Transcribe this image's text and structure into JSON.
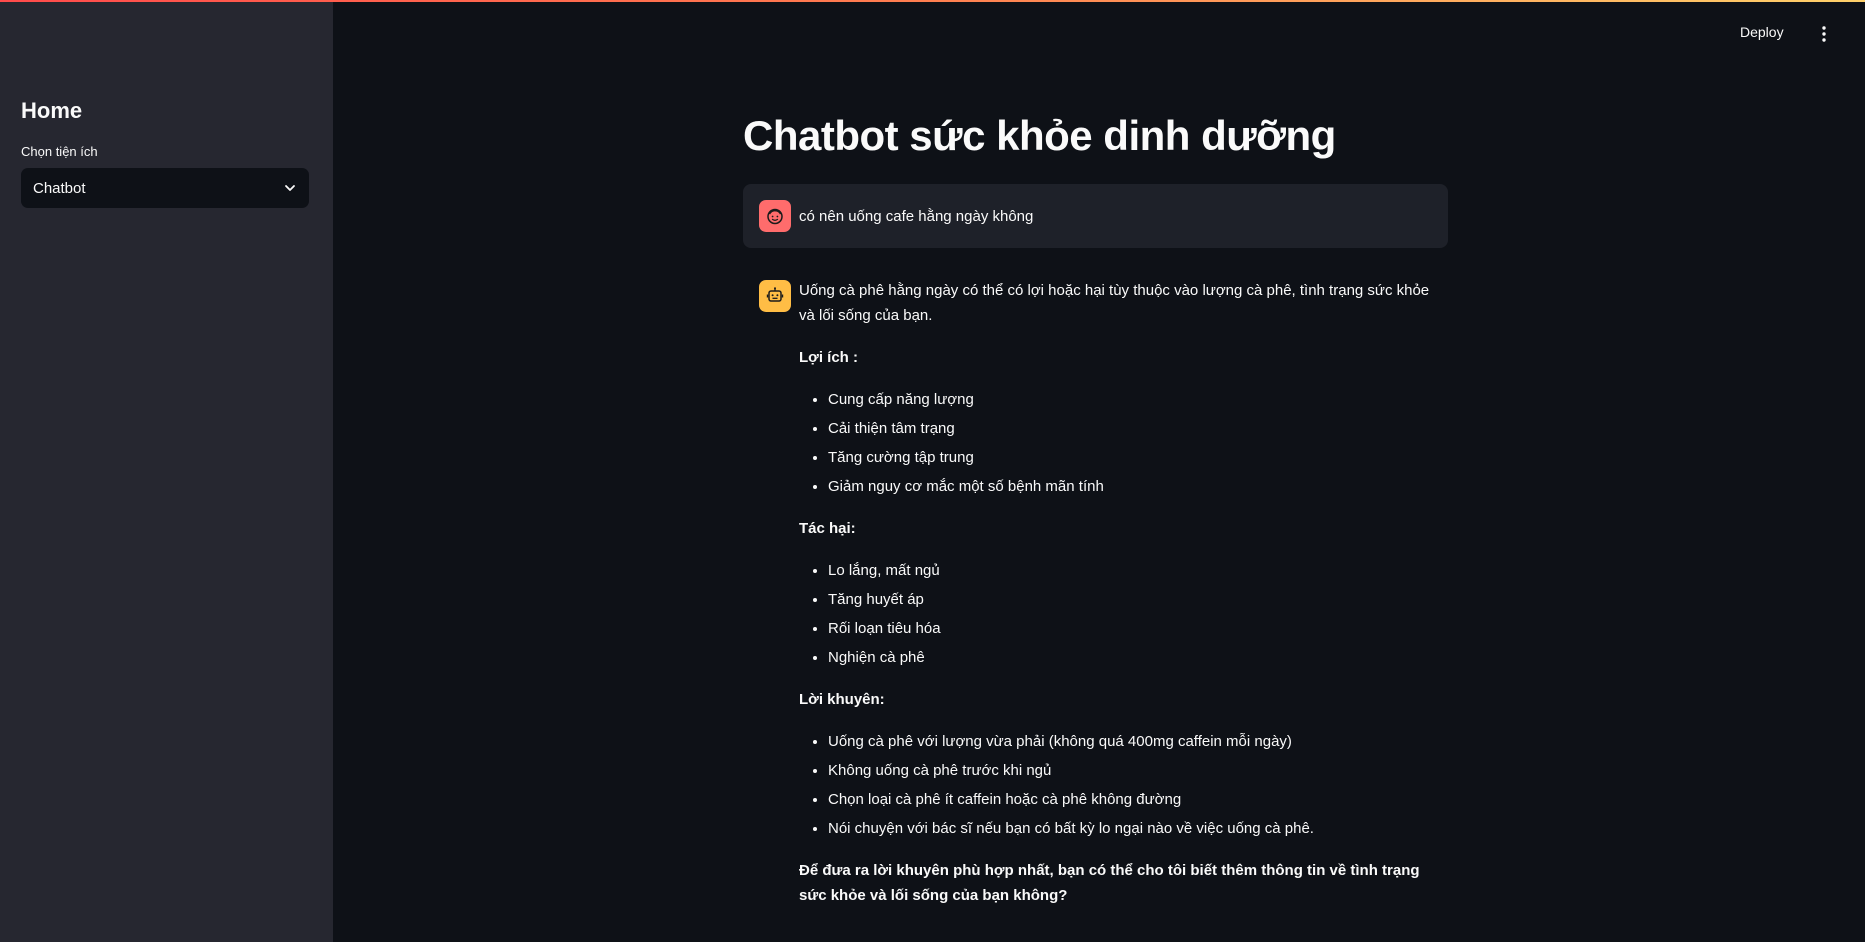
{
  "sidebar": {
    "title": "Home",
    "select_label": "Chọn tiện ích",
    "select_value": "Chatbot"
  },
  "header": {
    "deploy_label": "Deploy",
    "menu_icon": "vertical-dots-icon"
  },
  "main": {
    "title": "Chatbot sức khỏe dinh dưỡng",
    "user_message": {
      "avatar_icon": "user-face-icon",
      "avatar_color": "#ff6c6c",
      "text": "có nên uống cafe hằng ngày không"
    },
    "assistant_message": {
      "avatar_icon": "robot-icon",
      "avatar_color": "#ffbd45",
      "intro": "Uống cà phê hằng ngày có thể có lợi hoặc hại tùy thuộc vào lượng cà phê, tình trạng sức khỏe và lối sống của bạn.",
      "benefits_heading": "Lợi ích :",
      "benefits": [
        "Cung cấp năng lượng",
        "Cải thiện tâm trạng",
        "Tăng cường tập trung",
        "Giảm nguy cơ mắc một số bệnh mãn tính"
      ],
      "harms_heading": "Tác hại:",
      "harms": [
        "Lo lắng, mất ngủ",
        "Tăng huyết áp",
        "Rối loạn tiêu hóa",
        "Nghiện cà phê"
      ],
      "advice_heading": "Lời khuyên:",
      "advice": [
        "Uống cà phê với lượng vừa phải (không quá 400mg caffein mỗi ngày)",
        "Không uống cà phê trước khi ngủ",
        "Chọn loại cà phê ít caffein hoặc cà phê không đường",
        "Nói chuyện với bác sĩ nếu bạn có bất kỳ lo ngại nào về việc uống cà phê."
      ],
      "closing": "Để đưa ra lời khuyên phù hợp nhất, bạn có thể cho tôi biết thêm thông tin về tình trạng sức khỏe và lối sống của bạn không?"
    }
  }
}
